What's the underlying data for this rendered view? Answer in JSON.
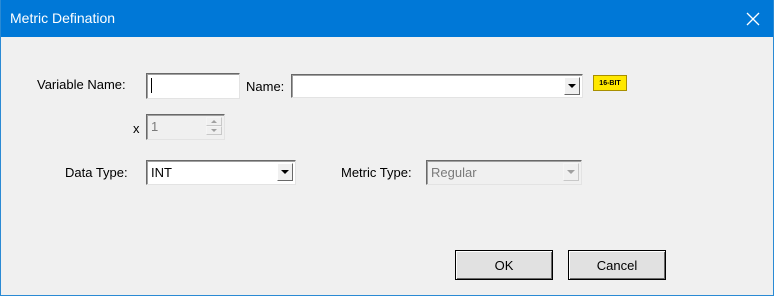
{
  "window": {
    "title": "Metric Defination",
    "close_label": "✕"
  },
  "form": {
    "variable_name_label": "Variable Name:",
    "variable_name_value": "",
    "name_label": "Name:",
    "name_value": "",
    "badge_text": "16-BIT",
    "count_label": "x",
    "count_value": "1",
    "data_type_label": "Data Type:",
    "data_type_value": "INT",
    "metric_type_label": "Metric Type:",
    "metric_type_value": "Regular"
  },
  "buttons": {
    "ok_label": "OK",
    "cancel_label": "Cancel"
  },
  "colors": {
    "titlebar": "#0078d7",
    "badge": "#ffe800",
    "dialog_bg": "#f0f0f0"
  }
}
